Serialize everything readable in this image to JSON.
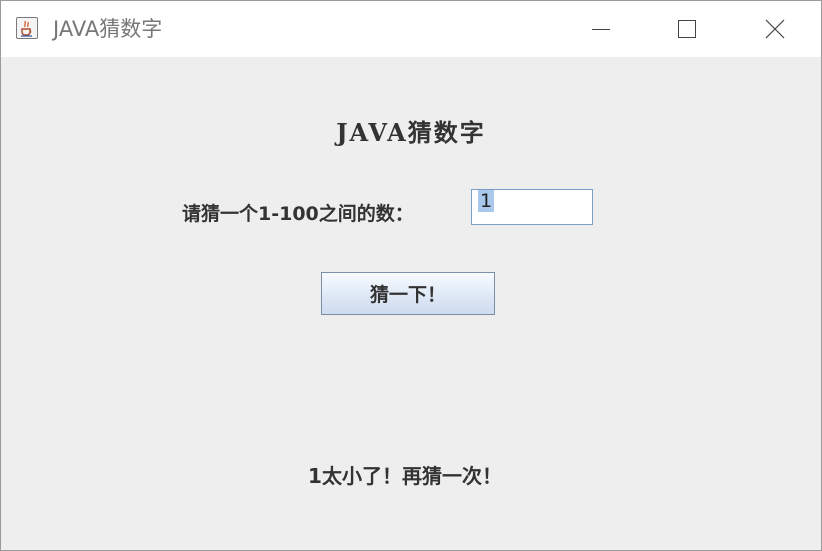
{
  "window": {
    "title": "JAVA猜数字",
    "icon": "java-cup-icon",
    "controls": [
      "minimize-icon",
      "maximize-icon",
      "close-icon"
    ]
  },
  "main": {
    "heading": "JAVA猜数字",
    "prompt_label": "请猜一个1-100之间的数：",
    "input_value": "1",
    "guess_button_label": "猜一下！",
    "result_text": "1太小了！再猜一次！"
  },
  "colors": {
    "content_background": "#eeeeee",
    "text": "#333333",
    "input_selection": "#a9c8ec"
  }
}
